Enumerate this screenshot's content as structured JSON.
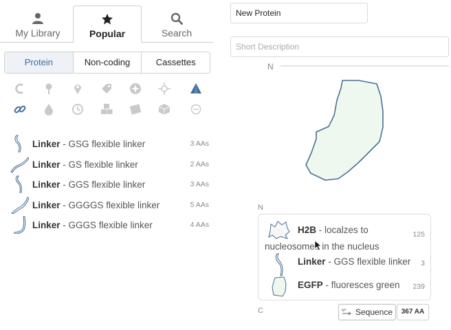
{
  "library_tabs": [
    {
      "label": "My Library",
      "icon": "user-icon"
    },
    {
      "label": "Popular",
      "icon": "star-icon",
      "active": true
    },
    {
      "label": "Search",
      "icon": "search-icon"
    }
  ],
  "part_types": [
    {
      "label": "Protein",
      "active": true
    },
    {
      "label": "Non-coding"
    },
    {
      "label": "Cassettes"
    }
  ],
  "feature_icons": [
    "c-terminus-icon",
    "pin-icon",
    "location-icon",
    "tag-icon",
    "compass-icon",
    "crosshair-icon",
    "pyramid-icon",
    "link-icon",
    "drop-icon",
    "clock-icon",
    "cubes-icon",
    "film-icon",
    "cube-icon",
    "minus-circle-icon"
  ],
  "parts": [
    {
      "name": "Linker",
      "desc": " - GSG flexible linker",
      "length": "3 AAs"
    },
    {
      "name": "Linker",
      "desc": " - GS flexible linker",
      "length": "2 AAs"
    },
    {
      "name": "Linker",
      "desc": " - GGS flexible linker",
      "length": "3 AAs"
    },
    {
      "name": "Linker",
      "desc": " - GGGGS flexible linker",
      "length": "5 AAs"
    },
    {
      "name": "Linker",
      "desc": " - GGGS flexible linker",
      "length": "4 AAs"
    }
  ],
  "editor": {
    "name_value": "New Protein",
    "description_placeholder": "Short Description",
    "n_label": "N",
    "c_label": "C",
    "sequence_button": "Sequence",
    "total_length": "367 AA"
  },
  "composition": [
    {
      "name": "H2B",
      "desc": " - localzes to nucleosomes in the nucleus",
      "count": "125"
    },
    {
      "name": "Linker",
      "desc": " - GGS flexible linker",
      "count": "3"
    },
    {
      "name": "EGFP",
      "desc": " - fluoresces green",
      "count": "239"
    }
  ],
  "colors": {
    "accent": "#3f6c9a",
    "blob_fill": "#eef8ee",
    "blob_stroke": "#4a6f93",
    "icon_gray": "#c9c9c9"
  }
}
